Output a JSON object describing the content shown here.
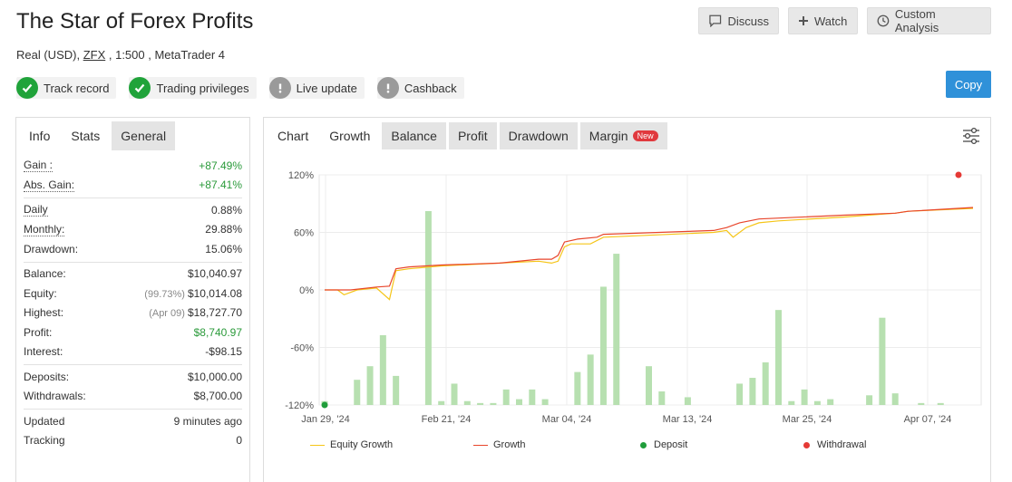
{
  "title": "The Star of Forex Profits",
  "account": {
    "prefix": "Real (USD), ",
    "broker": "ZFX",
    "suffix": " , 1:500 , MetaTrader 4"
  },
  "top_buttons": {
    "discuss": "Discuss",
    "watch": "Watch",
    "custom": "Custom Analysis"
  },
  "badges": [
    "Track record",
    "Trading privileges",
    "Live update",
    "Cashback"
  ],
  "copy_label": "Copy",
  "left_tabs": [
    "Info",
    "Stats",
    "General"
  ],
  "stats": {
    "gain": {
      "label": "Gain :",
      "value": "+87.49%"
    },
    "abs_gain": {
      "label": "Abs. Gain:",
      "value": "+87.41%"
    },
    "daily": {
      "label": "Daily",
      "value": "0.88%"
    },
    "monthly": {
      "label": "Monthly:",
      "value": "29.88%"
    },
    "drawdown": {
      "label": "Drawdown:",
      "value": "15.06%"
    },
    "balance": {
      "label": "Balance:",
      "value": "$10,040.97"
    },
    "equity": {
      "label": "Equity:",
      "note": "(99.73%)",
      "value": "$10,014.08"
    },
    "highest": {
      "label": "Highest:",
      "note": "(Apr 09)",
      "value": "$18,727.70"
    },
    "profit": {
      "label": "Profit:",
      "value": "$8,740.97"
    },
    "interest": {
      "label": "Interest:",
      "value": "-$98.15"
    },
    "deposits": {
      "label": "Deposits:",
      "value": "$10,000.00"
    },
    "withdrawals": {
      "label": "Withdrawals:",
      "value": "$8,700.00"
    },
    "updated": {
      "label": "Updated",
      "value": "9 minutes ago"
    },
    "tracking": {
      "label": "Tracking",
      "value": "0"
    }
  },
  "chart_tabs": [
    "Chart",
    "Growth",
    "Balance",
    "Profit",
    "Drawdown",
    "Margin"
  ],
  "new_badge": "New",
  "legend": {
    "equity": "Equity Growth",
    "growth": "Growth",
    "deposit": "Deposit",
    "withdrawal": "Withdrawal"
  },
  "colors": {
    "equity": "#f5c518",
    "growth": "#e8452b",
    "bars": "#b7e0b0",
    "deposit": "#1f9d3a",
    "withdrawal": "#e53935",
    "accent": "#2f91d9"
  },
  "chart_data": {
    "type": "line",
    "x_ticks": [
      "Jan 29, '24",
      "Feb 21, '24",
      "Mar 04, '24",
      "Mar 13, '24",
      "Mar 25, '24",
      "Apr 07, '24"
    ],
    "y_ticks": [
      "120%",
      "60%",
      "0%",
      "-60%",
      "-120%"
    ],
    "ylim": [
      -120,
      120
    ],
    "series": [
      {
        "name": "Equity Growth",
        "points": [
          [
            0,
            0
          ],
          [
            2,
            0
          ],
          [
            3,
            -5
          ],
          [
            5,
            0
          ],
          [
            8,
            2
          ],
          [
            10,
            -10
          ],
          [
            11,
            20
          ],
          [
            13,
            22
          ],
          [
            18,
            25
          ],
          [
            27,
            28
          ],
          [
            33,
            30
          ],
          [
            35,
            28
          ],
          [
            36,
            30
          ],
          [
            37,
            45
          ],
          [
            38,
            48
          ],
          [
            41,
            48
          ],
          [
            43,
            55
          ],
          [
            60,
            60
          ],
          [
            62,
            62
          ],
          [
            63,
            55
          ],
          [
            64,
            60
          ],
          [
            65,
            65
          ],
          [
            67,
            70
          ],
          [
            70,
            72
          ],
          [
            80,
            76
          ],
          [
            88,
            80
          ],
          [
            90,
            82
          ],
          [
            100,
            85
          ]
        ]
      },
      {
        "name": "Growth",
        "points": [
          [
            0,
            0
          ],
          [
            4,
            0
          ],
          [
            8,
            3
          ],
          [
            10,
            4
          ],
          [
            11,
            22
          ],
          [
            13,
            24
          ],
          [
            18,
            26
          ],
          [
            27,
            28
          ],
          [
            33,
            32
          ],
          [
            35,
            32
          ],
          [
            36,
            36
          ],
          [
            37,
            50
          ],
          [
            39,
            53
          ],
          [
            42,
            55
          ],
          [
            43,
            58
          ],
          [
            60,
            62
          ],
          [
            62,
            65
          ],
          [
            64,
            70
          ],
          [
            67,
            74
          ],
          [
            80,
            78
          ],
          [
            88,
            80
          ],
          [
            90,
            82
          ],
          [
            100,
            86
          ]
        ]
      }
    ],
    "bars": [
      [
        0,
        0.02
      ],
      [
        5,
        0.13
      ],
      [
        7,
        0.2
      ],
      [
        9,
        0.36
      ],
      [
        11,
        0.15
      ],
      [
        16,
        1.0
      ],
      [
        18,
        0.02
      ],
      [
        20,
        0.11
      ],
      [
        22,
        0.02
      ],
      [
        24,
        0.01
      ],
      [
        26,
        0.01
      ],
      [
        28,
        0.08
      ],
      [
        30,
        0.03
      ],
      [
        32,
        0.08
      ],
      [
        34,
        0.03
      ],
      [
        39,
        0.17
      ],
      [
        41,
        0.26
      ],
      [
        43,
        0.61
      ],
      [
        45,
        0.78
      ],
      [
        50,
        0.2
      ],
      [
        52,
        0.07
      ],
      [
        56,
        0.04
      ],
      [
        64,
        0.11
      ],
      [
        66,
        0.14
      ],
      [
        68,
        0.22
      ],
      [
        70,
        0.49
      ],
      [
        72,
        0.02
      ],
      [
        74,
        0.08
      ],
      [
        76,
        0.02
      ],
      [
        78,
        0.03
      ],
      [
        84,
        0.05
      ],
      [
        86,
        0.45
      ],
      [
        88,
        0.06
      ],
      [
        92,
        0.01
      ],
      [
        95,
        0.01
      ]
    ],
    "deposit_points": [
      [
        0,
        -120
      ]
    ],
    "withdrawal_points": [
      [
        100,
        120
      ]
    ]
  }
}
